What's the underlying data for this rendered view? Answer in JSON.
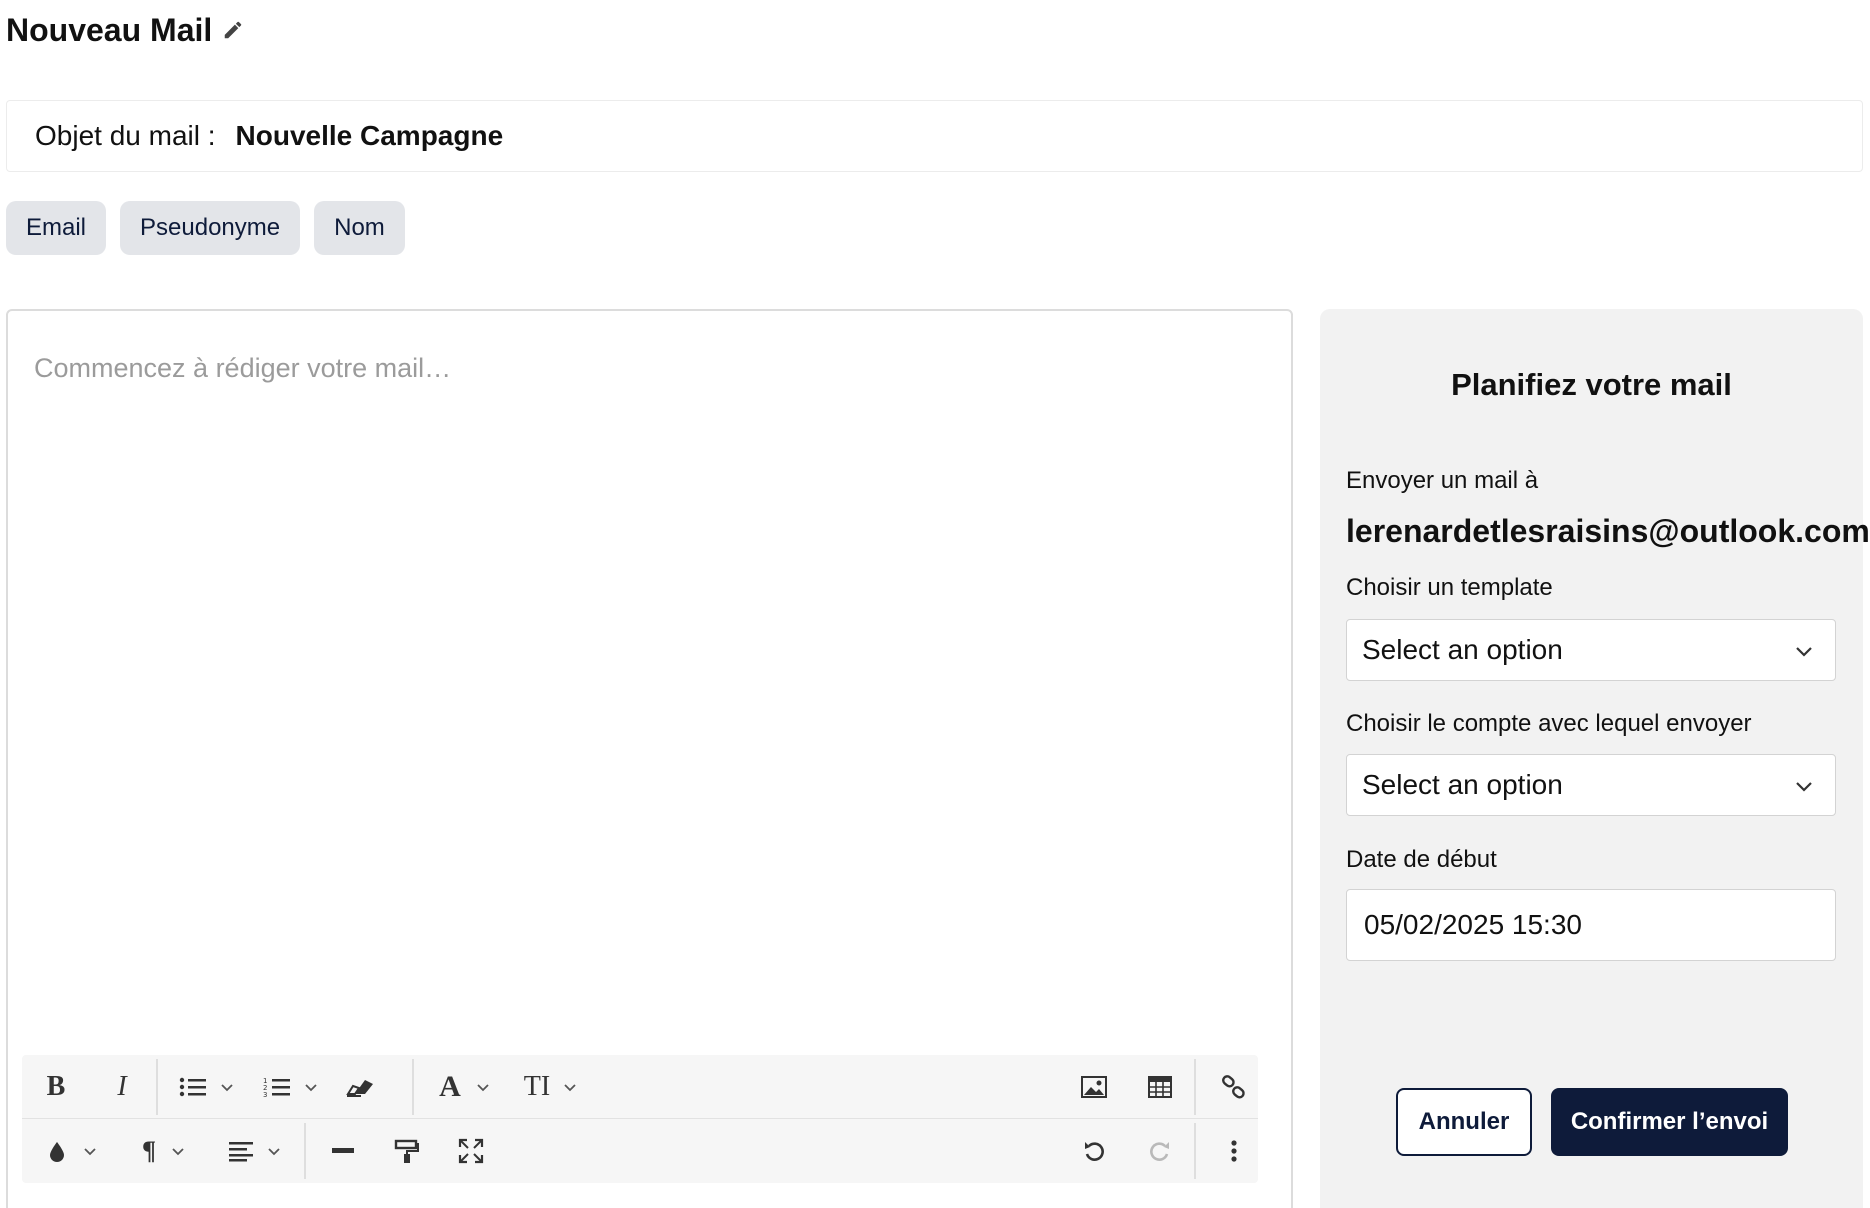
{
  "header": {
    "title": "Nouveau Mail"
  },
  "subject": {
    "label": "Objet du mail :",
    "value": "Nouvelle Campagne"
  },
  "variables": [
    "Email",
    "Pseudonyme",
    "Nom"
  ],
  "editor": {
    "placeholder": "Commencez à rédiger votre mail…",
    "toolbar_icons_row1": [
      "bold-icon",
      "italic-icon",
      "bullet-list-icon",
      "numbered-list-icon",
      "eraser-icon",
      "font-icon",
      "font-size-icon",
      "image-icon",
      "table-icon",
      "link-icon"
    ],
    "toolbar_icons_row2": [
      "color-drop-icon",
      "paragraph-icon",
      "align-icon",
      "horizontal-rule-icon",
      "format-painter-icon",
      "fullscreen-icon",
      "undo-icon",
      "redo-icon",
      "more-icon"
    ],
    "bold_glyph": "B",
    "italic_glyph": "I",
    "font_glyph": "A",
    "font_size_glyph": "TI",
    "paragraph_glyph": "¶"
  },
  "schedule": {
    "title": "Planifiez votre mail",
    "send_to_label": "Envoyer un mail à",
    "recipient": "lerenardetlesraisins@outlook.com",
    "template_label": "Choisir un template",
    "template_value": "Select an option",
    "account_label": "Choisir le compte avec lequel envoyer",
    "account_value": "Select an option",
    "date_label": "Date de début",
    "date_value": "05/02/2025 15:30",
    "cancel_label": "Annuler",
    "confirm_label": "Confirmer l’envoi"
  },
  "colors": {
    "navy": "#0e1b3a",
    "chip_bg": "#e3e5e9",
    "panel_bg": "#f2f2f2"
  }
}
